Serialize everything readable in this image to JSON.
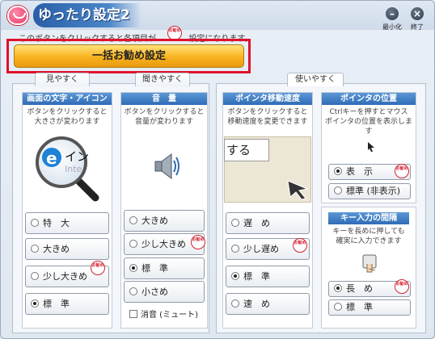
{
  "window": {
    "title": "ゆったり設定2",
    "minimize_label": "最小化",
    "close_label": "終了"
  },
  "hint": {
    "text": "このボタンをクリックすると各項目が",
    "text_suffix": "設定になります。"
  },
  "bulk_button": {
    "label": "一括お勧め設定"
  },
  "stamp_text": "お勧め",
  "tabs": {
    "see": "見やすく",
    "hear": "聞きやすく",
    "use": "使いやすく"
  },
  "text_icon_panel": {
    "title": "画面の文字・アイコン",
    "desc_line1": "ボタンをクリックすると",
    "desc_line2": "大きさが変わります",
    "preview_text1": "イン",
    "preview_text2": "Inte",
    "options": [
      {
        "label": "特　大",
        "selected": false,
        "recommended": false
      },
      {
        "label": "大きめ",
        "selected": false,
        "recommended": false
      },
      {
        "label": "少し大きめ",
        "selected": false,
        "recommended": true
      },
      {
        "label": "標　準",
        "selected": true,
        "recommended": false
      }
    ]
  },
  "volume_panel": {
    "title": "音　量",
    "desc_line1": "ボタンをクリックすると",
    "desc_line2": "音量が変わります",
    "options": [
      {
        "label": "大きめ",
        "selected": false,
        "recommended": false
      },
      {
        "label": "少し大きめ",
        "selected": false,
        "recommended": true
      },
      {
        "label": "標　準",
        "selected": true,
        "recommended": false
      },
      {
        "label": "小さめ",
        "selected": false,
        "recommended": false
      }
    ],
    "mute_label": "消音 (ミュート)"
  },
  "pointer_speed_panel": {
    "title": "ポインタ移動速度",
    "desc_line1": "ボタンをクリックすると",
    "desc_line2": "移動速度を変更できます",
    "preview_text": "する",
    "options": [
      {
        "label": "遅　め",
        "selected": false,
        "recommended": false
      },
      {
        "label": "少し遅め",
        "selected": false,
        "recommended": true
      },
      {
        "label": "標　準",
        "selected": true,
        "recommended": false
      },
      {
        "label": "速　め",
        "selected": false,
        "recommended": false
      }
    ]
  },
  "pointer_position_panel": {
    "title": "ポインタの位置",
    "desc_line1": "Ctrlキーを押すとマウス",
    "desc_line2": "ポインタの位置を表示します",
    "options": [
      {
        "label": "表　示",
        "selected": true,
        "recommended": true
      },
      {
        "label": "標準 (非表示)",
        "selected": false,
        "recommended": false
      }
    ]
  },
  "key_interval_panel": {
    "title": "キー入力の間隔",
    "desc_line1": "キーを長めに押しても",
    "desc_line2": "確実に入力できます",
    "options": [
      {
        "label": "長　め",
        "selected": true,
        "recommended": true
      },
      {
        "label": "標　準",
        "selected": false,
        "recommended": false
      }
    ]
  }
}
